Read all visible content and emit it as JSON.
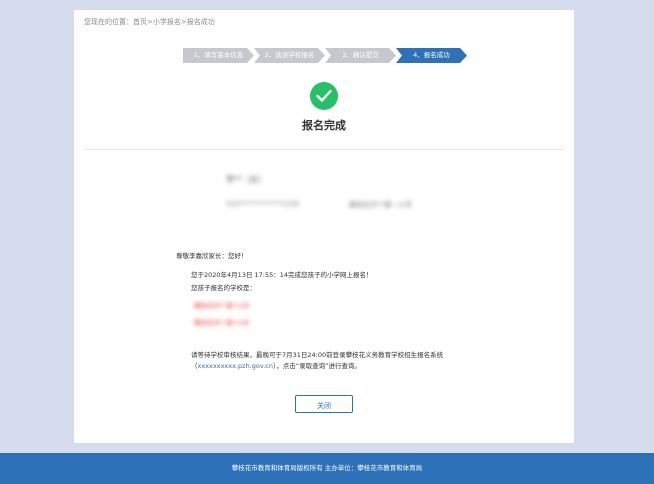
{
  "breadcrumb": {
    "prefix": "您现在的位置：",
    "home": "首页",
    "sep1": ">",
    "section": "小学报名",
    "sep2": ">",
    "current": "报名成功"
  },
  "steps": [
    {
      "label": "1、填写基本信息"
    },
    {
      "label": "2、选读学校报名"
    },
    {
      "label": "3、确认提交"
    },
    {
      "label": "4、报名成功"
    }
  ],
  "result": {
    "title": "报名完成"
  },
  "applicant": {
    "name": "李**（女）",
    "id_number": "510************1234",
    "school": "攀枝花市**第一小学"
  },
  "message": {
    "greeting": "尊敬李嘉欣家长：您好！",
    "completed": "您于2020年4月13日 17:55：14完成您孩子的小学网上报名！",
    "schools_label": "您孩子报名的学校是：",
    "schools": [
      "攀枝花市**第*小学",
      "攀枝花市**第*小学"
    ],
    "notice_line1": "请等待学校审核结果，最晚可于7月31日24:00前登录攀枝花义务教育学校招生报名系统",
    "notice_open": "（",
    "notice_link": "xxxxxxxxxx.pzh.gov.cn",
    "notice_rest": "），点击“录取查询”进行查询。"
  },
  "buttons": {
    "close": "关闭"
  },
  "footer": {
    "text": "攀枝花市教育和体育局版权所有  主办单位：攀枝花市教育和体育局"
  },
  "colors": {
    "accent": "#2d72b8",
    "success": "#27c069",
    "step_inactive": "#c5c8cd",
    "background": "#d6dced"
  }
}
